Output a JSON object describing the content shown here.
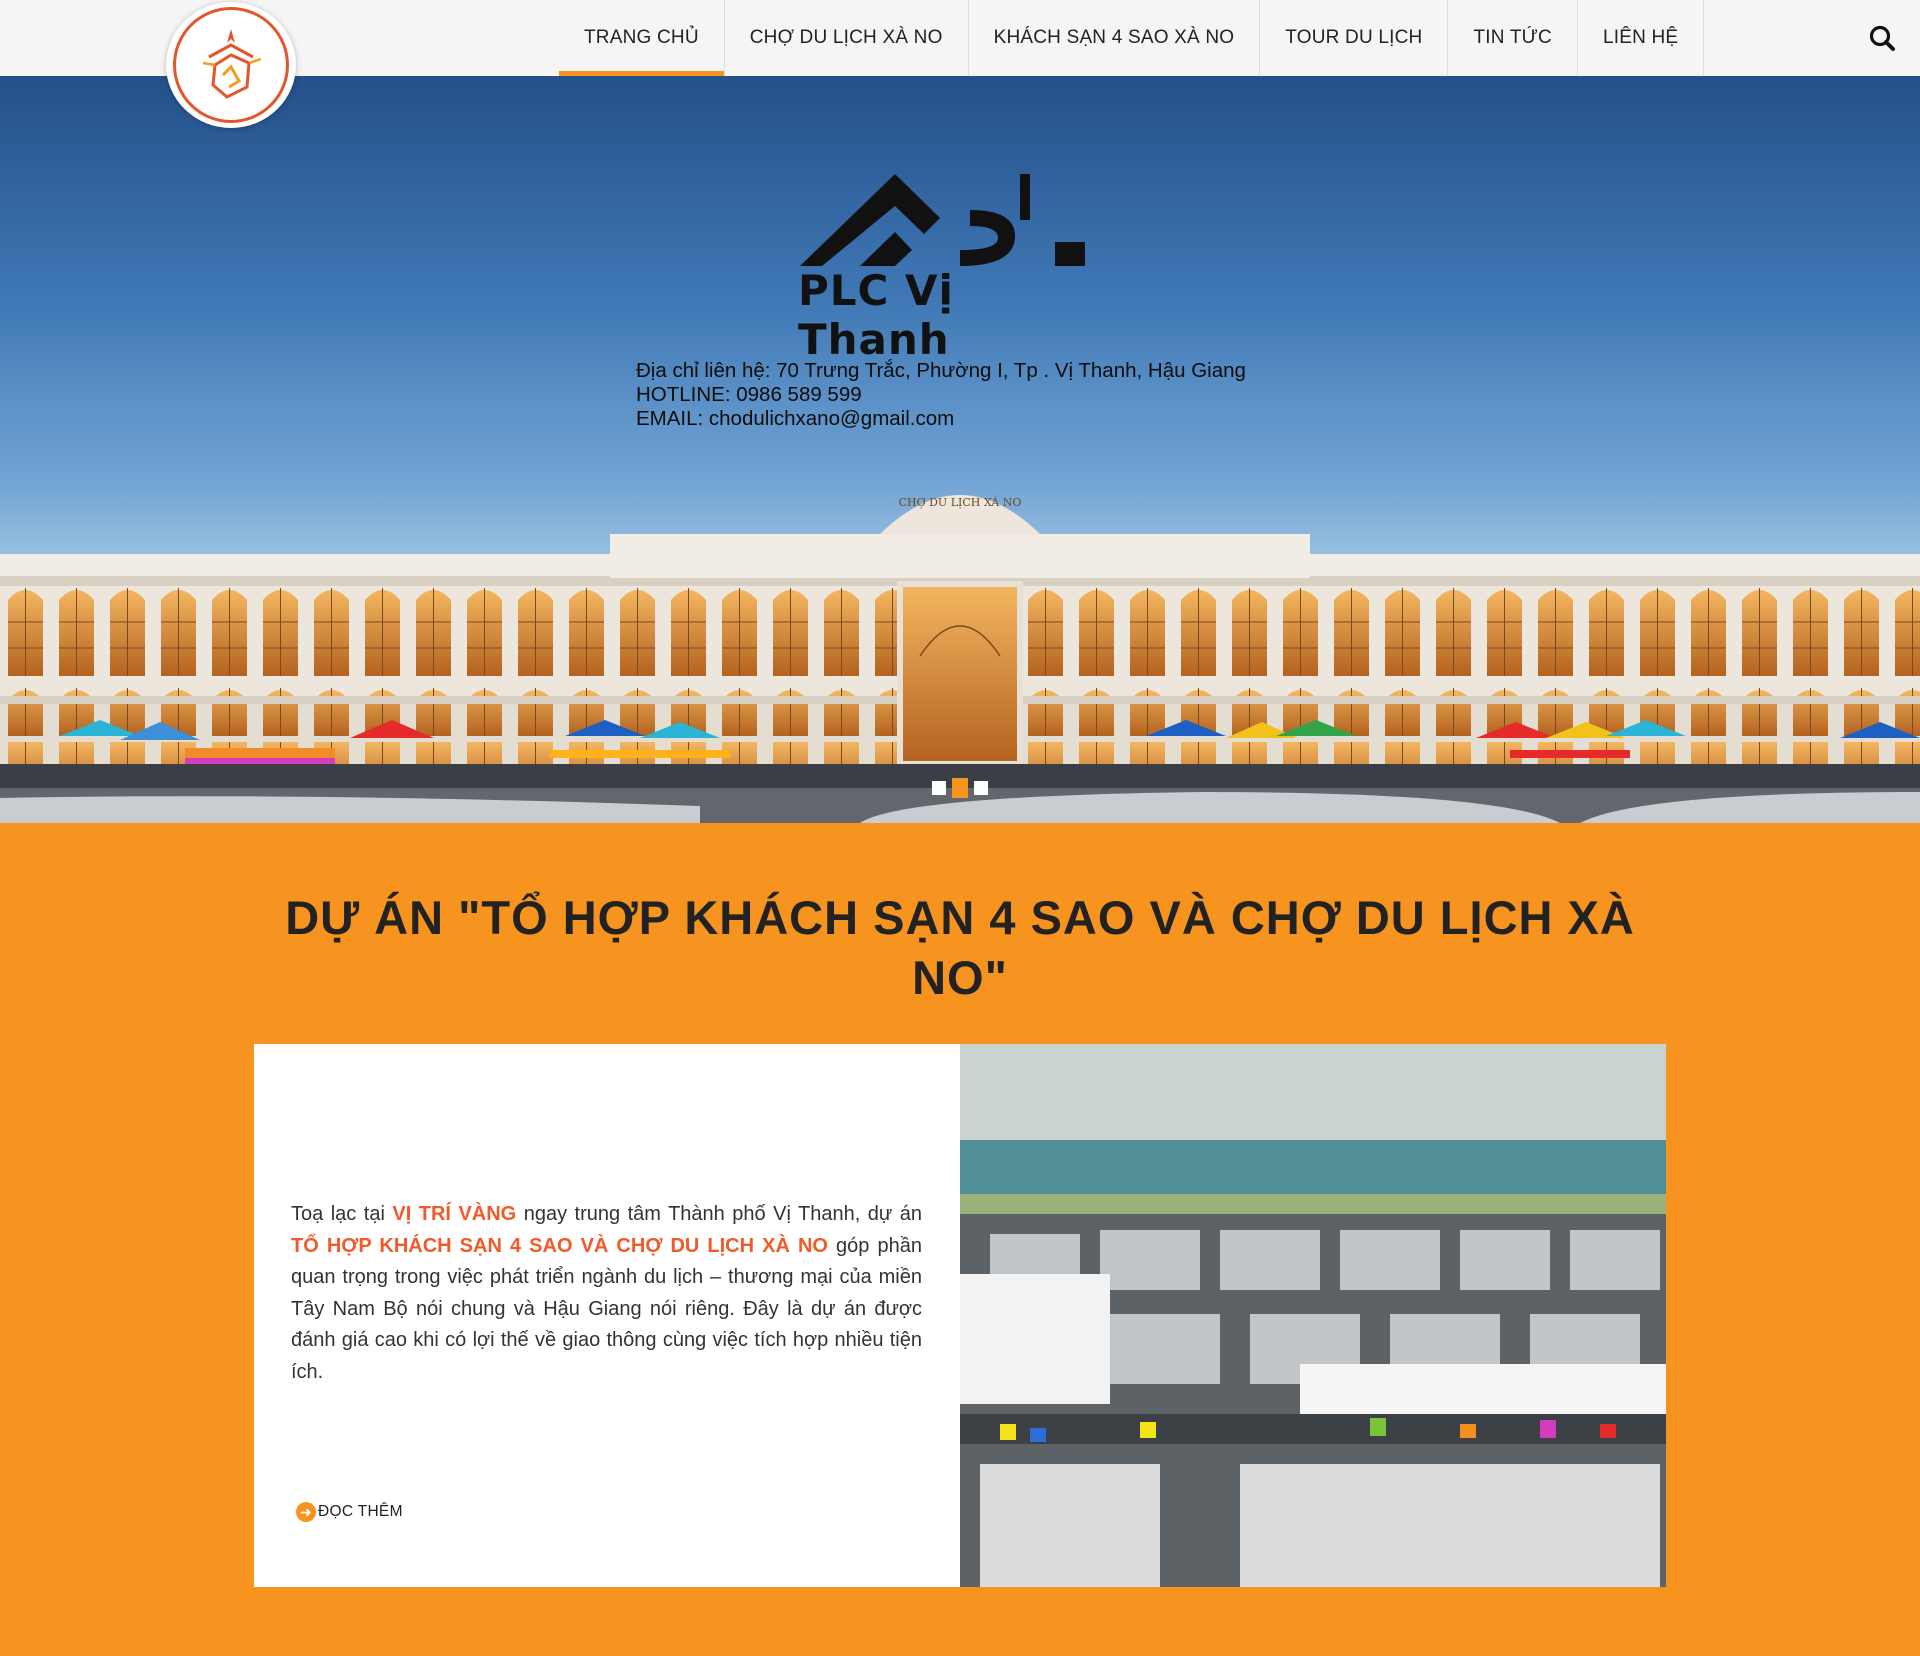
{
  "header": {
    "logo_icon": "xa-no-logo-icon",
    "nav": [
      {
        "label": "TRANG CHỦ",
        "active": true
      },
      {
        "label": "CHỢ DU LỊCH XÀ NO",
        "active": false
      },
      {
        "label": "KHÁCH SẠN 4 SAO XÀ NO",
        "active": false
      },
      {
        "label": "TOUR DU LỊCH",
        "active": false
      },
      {
        "label": "TIN TỨC",
        "active": false
      },
      {
        "label": "LIÊN HỆ",
        "active": false
      }
    ],
    "search_icon": "search-icon"
  },
  "hero": {
    "brand": "PLC Vị Thanh",
    "contact_address": "Địa chỉ liên hệ: 70 Trưng Trắc, Phường I, Tp . Vị Thanh, Hậu Giang",
    "contact_hotline": "HOTLINE: 0986 589 599",
    "contact_email": "EMAIL: chodulichxano@gmail.com",
    "building_sign": "CHỢ DU LỊCH XÀ NO",
    "slides": 3,
    "active_slide": 2
  },
  "section": {
    "title": "DỰ ÁN \"TỔ HỢP KHÁCH SẠN 4 SAO VÀ CHỢ DU LỊCH XÀ NO\"",
    "body_1": "Toạ lạc tại ",
    "highlight_1": "VỊ TRÍ VÀNG",
    "body_2": " ngay trung tâm Thành phố Vị Thanh, dự án ",
    "highlight_2": "TỔ HỢP KHÁCH SẠN 4 SAO VÀ CHỢ DU LỊCH XÀ NO",
    "body_3": " góp phần quan trọng trong việc phát triển ngành du lịch – thương mại của miền Tây Nam Bộ nói chung và Hậu Giang nói riêng. Đây là dự án được đánh giá cao khi có lợi thế về giao thông cùng việc tích hợp nhiều tiện ích.",
    "read_more": "ĐỌC THÊM",
    "read_more_icon": "circle-arrow-right-icon"
  },
  "colors": {
    "accent": "#f7941f",
    "highlight": "#f15a29",
    "header_bg": "#f5f5f5"
  }
}
